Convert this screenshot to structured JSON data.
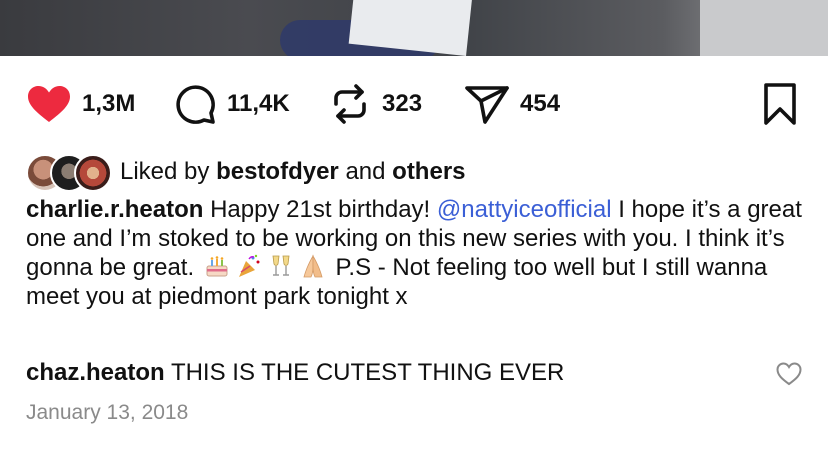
{
  "actions": {
    "likes": "1,3M",
    "comments": "11,4K",
    "reposts": "323",
    "shares": "454",
    "like_color": "#ed2a3f"
  },
  "liked_by": {
    "prefix": "Liked by",
    "user": "bestofdyer",
    "conjunction": "and",
    "others": "others"
  },
  "caption": {
    "username": "charlie.r.heaton",
    "text_before_mention": "Happy 21st birthday!",
    "mention": "@nattyiceofficial",
    "text_after_mention": "I hope it’s a great one and I’m stoked to be working on this new series with you. I think it’s gonna be great.",
    "emojis": [
      "birthday-cake",
      "party-popper",
      "champagne-glasses",
      "folded-hands"
    ],
    "text_after_emojis": "P.S - Not feeling too well but I still wanna meet you at piedmont park tonight x",
    "mention_color": "#3b5fd6"
  },
  "comment": {
    "username": "chaz.heaton",
    "text": "THIS IS THE CUTEST THING EVER"
  },
  "date": "January 13, 2018"
}
